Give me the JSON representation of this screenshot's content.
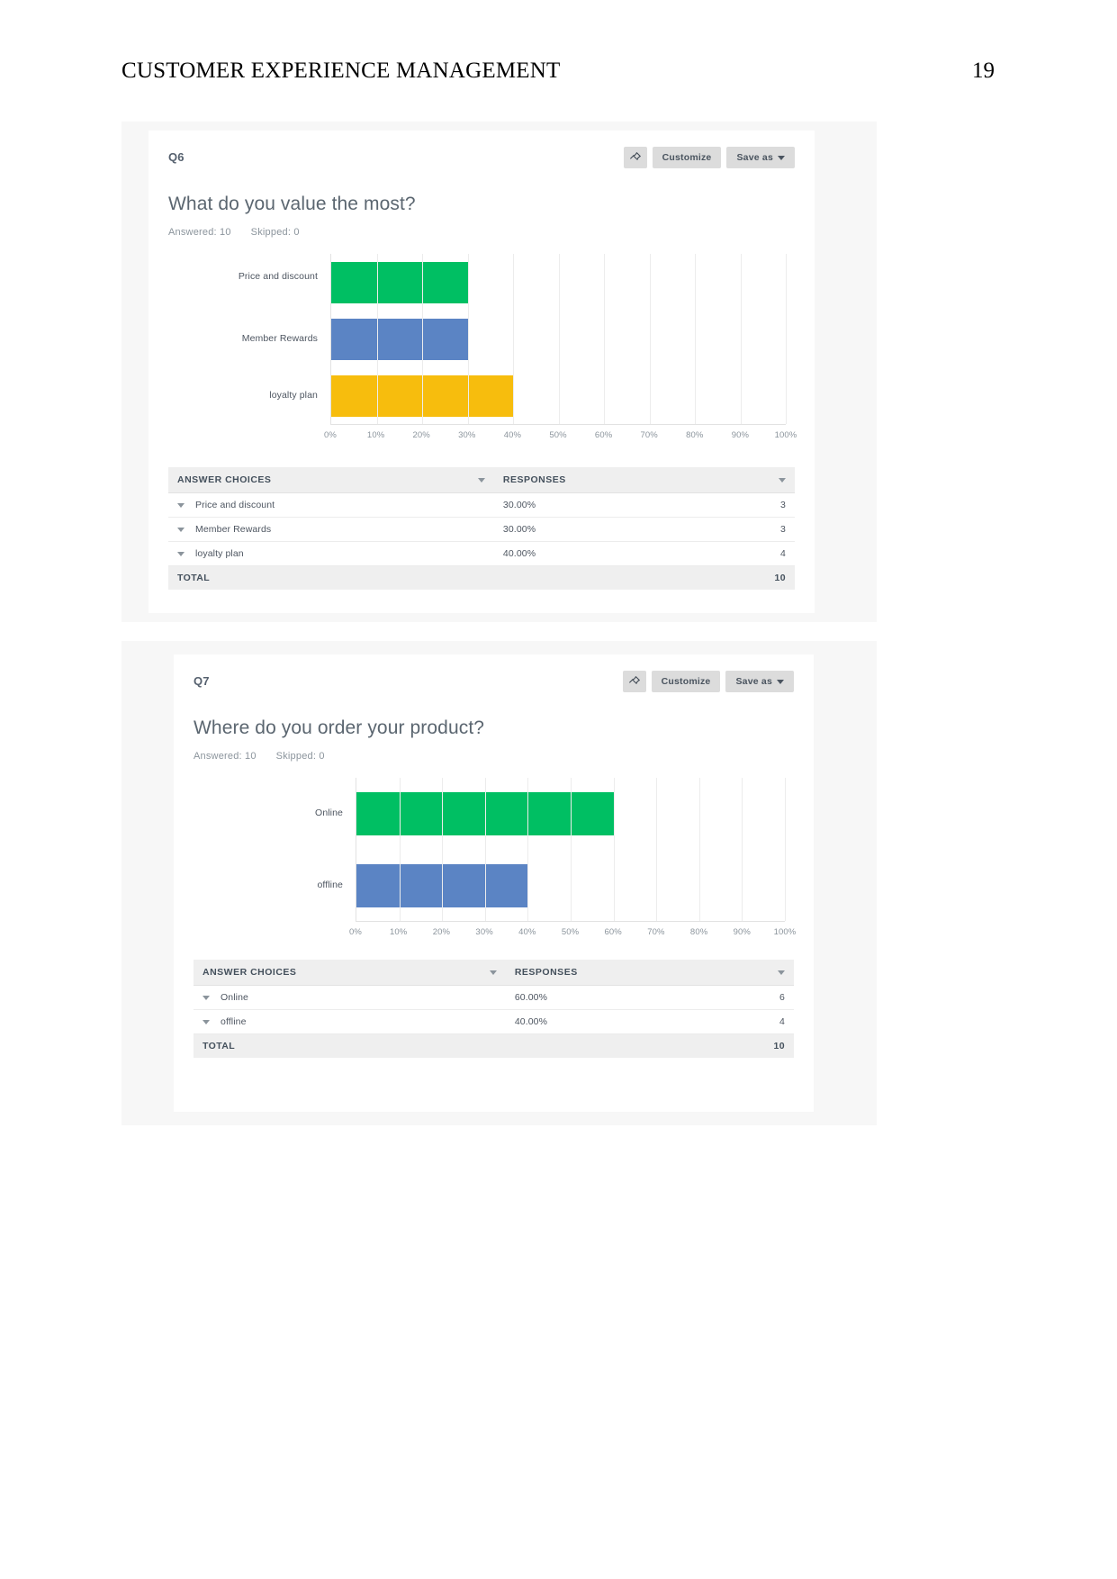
{
  "page": {
    "doc_title": "CUSTOMER EXPERIENCE MANAGEMENT",
    "page_number": "19"
  },
  "colors": {
    "green": "#00bf63",
    "blue": "#5b84c4",
    "yellow": "#f7bd0d",
    "button_bg": "#dcdcdc",
    "header_bg": "#efefef"
  },
  "cards": [
    {
      "q_label": "Q6",
      "title": "What do you value the most?",
      "answered": "Answered: 10",
      "skipped": "Skipped: 0",
      "actions": {
        "pin_icon": "pin-icon",
        "customize_label": "Customize",
        "save_as_label": "Save as"
      },
      "table": {
        "col_choices": "ANSWER CHOICES",
        "col_responses": "RESPONSES",
        "rows": [
          {
            "choice": "Price and discount",
            "percent": "30.00%",
            "count": "3"
          },
          {
            "choice": "Member Rewards",
            "percent": "30.00%",
            "count": "3"
          },
          {
            "choice": "loyalty plan",
            "percent": "40.00%",
            "count": "4"
          }
        ],
        "total_label": "TOTAL",
        "total_count": "10"
      },
      "chart_data": {
        "type": "bar",
        "orientation": "horizontal",
        "title": "What do you value the most?",
        "xlabel": "",
        "ylabel": "",
        "xlim": [
          0,
          100
        ],
        "grid": true,
        "legend": "none",
        "tick_labels": [
          "0%",
          "10%",
          "20%",
          "30%",
          "40%",
          "50%",
          "60%",
          "70%",
          "80%",
          "90%",
          "100%"
        ],
        "categories": [
          "Price and discount",
          "Member Rewards",
          "loyalty plan"
        ],
        "values": [
          30,
          30,
          40
        ],
        "counts": [
          3,
          3,
          4
        ],
        "bar_colors": [
          "#00bf63",
          "#5b84c4",
          "#f7bd0d"
        ]
      }
    },
    {
      "q_label": "Q7",
      "title": "Where do you order your product?",
      "answered": "Answered: 10",
      "skipped": "Skipped: 0",
      "actions": {
        "pin_icon": "pin-icon",
        "customize_label": "Customize",
        "save_as_label": "Save as"
      },
      "table": {
        "col_choices": "ANSWER CHOICES",
        "col_responses": "RESPONSES",
        "rows": [
          {
            "choice": "Online",
            "percent": "60.00%",
            "count": "6"
          },
          {
            "choice": "offline",
            "percent": "40.00%",
            "count": "4"
          }
        ],
        "total_label": "TOTAL",
        "total_count": "10"
      },
      "chart_data": {
        "type": "bar",
        "orientation": "horizontal",
        "title": "Where do you order your product?",
        "xlabel": "",
        "ylabel": "",
        "xlim": [
          0,
          100
        ],
        "grid": true,
        "legend": "none",
        "tick_labels": [
          "0%",
          "10%",
          "20%",
          "30%",
          "40%",
          "50%",
          "60%",
          "70%",
          "80%",
          "90%",
          "100%"
        ],
        "categories": [
          "Online",
          "offline"
        ],
        "values": [
          60,
          40
        ],
        "counts": [
          6,
          4
        ],
        "bar_colors": [
          "#00bf63",
          "#5b84c4"
        ]
      }
    }
  ]
}
